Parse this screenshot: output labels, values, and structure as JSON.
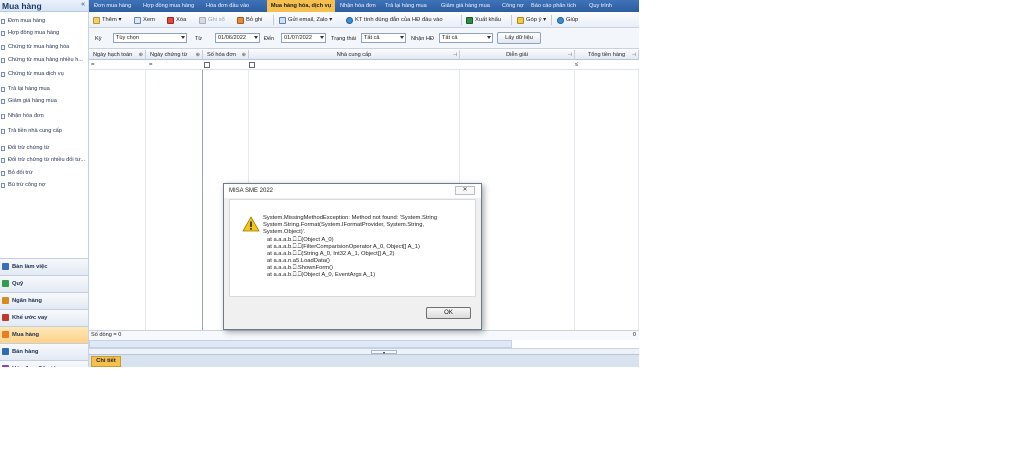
{
  "sidebar": {
    "title": "Mua hàng",
    "collapse_icon": "«",
    "items": [
      {
        "label": "Đơn mua hàng"
      },
      {
        "label": "Hợp đồng mua hàng"
      },
      {
        "label": "Chứng từ mua hàng hóa"
      },
      {
        "label": "Chứng từ mua hàng nhiều h..."
      },
      {
        "label": "Chứng từ mua dịch vụ"
      },
      {
        "label": "Trả lại hàng mua"
      },
      {
        "label": "Giảm giá hàng mua"
      },
      {
        "label": "Nhận hóa đơn"
      },
      {
        "label": "Trả tiền nhà cung cấp"
      },
      {
        "label": "Đối trừ chứng từ"
      },
      {
        "label": "Đối trừ chứng từ nhiều đối tư..."
      },
      {
        "label": "Bỏ đối trừ"
      },
      {
        "label": "Bù trừ công nợ"
      }
    ],
    "modules": [
      {
        "label": "Bàn làm việc",
        "color": "#3b6fb6"
      },
      {
        "label": "Quỹ",
        "color": "#2e9e4f"
      },
      {
        "label": "Ngân hàng",
        "color": "#d98b1e"
      },
      {
        "label": "Khế ước vay",
        "color": "#c0392b"
      },
      {
        "label": "Mua hàng",
        "color": "#e67e22"
      },
      {
        "label": "Bán hàng",
        "color": "#2f6db5"
      },
      {
        "label": "Hóa đơn điện tử",
        "color": "#8e44ad"
      }
    ]
  },
  "tabs": [
    {
      "label": "Đơn mua hàng"
    },
    {
      "label": "Hợp đồng mua hàng"
    },
    {
      "label": "Hóa đơn đầu vào"
    },
    {
      "label": "Mua hàng hóa, dịch vụ"
    },
    {
      "label": "Nhận hóa đơn"
    },
    {
      "label": "Trả lại hàng mua"
    },
    {
      "label": "Giảm giá hàng mua"
    },
    {
      "label": "Công nợ"
    },
    {
      "label": "Báo cáo phân tích"
    },
    {
      "label": "Quy trình"
    }
  ],
  "toolbar": {
    "add": "Thêm",
    "view": "Xem",
    "delete": "Xóa",
    "post": "Ghi sổ",
    "unpost": "Bỏ ghi",
    "send": "Gửi email, Zalo",
    "check": "KT tính đúng đắn của HĐ đầu vào",
    "export": "Xuất khẩu",
    "feedback": "Góp ý",
    "help": "Giúp"
  },
  "filter": {
    "period_label": "Kỳ",
    "period_value": "Tùy chọn",
    "from_label": "Từ",
    "from_value": "01/06/2022",
    "to_label": "Đến",
    "to_value": "01/07/2022",
    "status_label": "Trạng thái",
    "status_value": "Tất cả",
    "invoice_label": "Nhận HĐ",
    "invoice_value": "Tất cả",
    "get_data": "Lấy dữ liệu"
  },
  "grid": {
    "headers": [
      "Ngày hạch toán",
      "Ngày chứng từ",
      "Số hóa đơn",
      "Nhà cung cấp",
      "Diễn giải",
      "Tổng tiền hàng"
    ],
    "filter_ops": [
      "=",
      "=",
      "≤"
    ],
    "row_count_label": "Số dòng = 0",
    "row_count_total": "0"
  },
  "detail": {
    "tab": "Chi tiết"
  },
  "dialog": {
    "title": "MISA SME 2022",
    "close": "✕",
    "lines": [
      "System.MissingMethodException: Method not found: 'System.String",
      "System.String.Format(System.IFormatProvider, System.String,",
      "System.Object)'.",
      "at a.a.a.b.⎕.⎕(Object A_0)",
      "at a.a.a.b.⎕.⎕(FilterComparisionOperator A_0, Object[] A_1)",
      "at a.a.a.b.⎕.⎕(String A_0, Int32 A_1, Object[] A_2)",
      "at a.a.a.n.a5.LoadData()",
      "at a.a.a.b.⎕.ShownForm()",
      "at a.a.a.b.⎕.⎕(Object A_0, EventArgs A_1)"
    ],
    "ok": "OK"
  }
}
